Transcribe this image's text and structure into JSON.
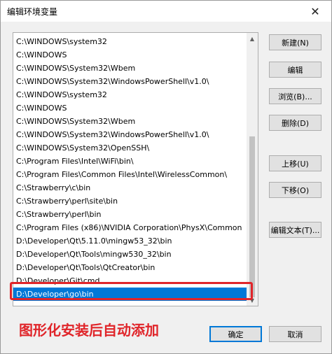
{
  "window": {
    "title": "编辑环境变量",
    "close_glyph": "✕"
  },
  "path_list": {
    "items": [
      "C:\\WINDOWS\\system32",
      "C:\\WINDOWS",
      "C:\\WINDOWS\\System32\\Wbem",
      "C:\\WINDOWS\\System32\\WindowsPowerShell\\v1.0\\",
      "C:\\WINDOWS\\system32",
      "C:\\WINDOWS",
      "C:\\WINDOWS\\System32\\Wbem",
      "C:\\WINDOWS\\System32\\WindowsPowerShell\\v1.0\\",
      "C:\\WINDOWS\\System32\\OpenSSH\\",
      "C:\\Program Files\\Intel\\WiFi\\bin\\",
      "C:\\Program Files\\Common Files\\Intel\\WirelessCommon\\",
      "C:\\Strawberry\\c\\bin",
      "C:\\Strawberry\\perl\\site\\bin",
      "C:\\Strawberry\\perl\\bin",
      "C:\\Program Files (x86)\\NVIDIA Corporation\\PhysX\\Common",
      "D:\\Developer\\Qt\\5.11.0\\mingw53_32\\bin",
      "D:\\Developer\\Qt\\Tools\\mingw530_32\\bin",
      "D:\\Developer\\Qt\\Tools\\QtCreator\\bin",
      "D:\\Developer\\Git\\cmd",
      "D:\\Developer\\go\\bin"
    ],
    "selected_index": 19
  },
  "buttons": {
    "new": "新建(N)",
    "edit": "编辑",
    "browse": "浏览(B)...",
    "delete": "删除(D)",
    "move_up": "上移(U)",
    "move_down": "下移(O)",
    "edit_text": "编辑文本(T)...",
    "ok": "确定",
    "cancel": "取消"
  },
  "annotation": {
    "text": "图形化安装后自动添加",
    "color": "#e0252a"
  },
  "colors": {
    "selection": "#0078d7",
    "highlight_border": "#e0252a"
  },
  "icons": {
    "scroll_up": "▲",
    "scroll_down": "▼"
  }
}
